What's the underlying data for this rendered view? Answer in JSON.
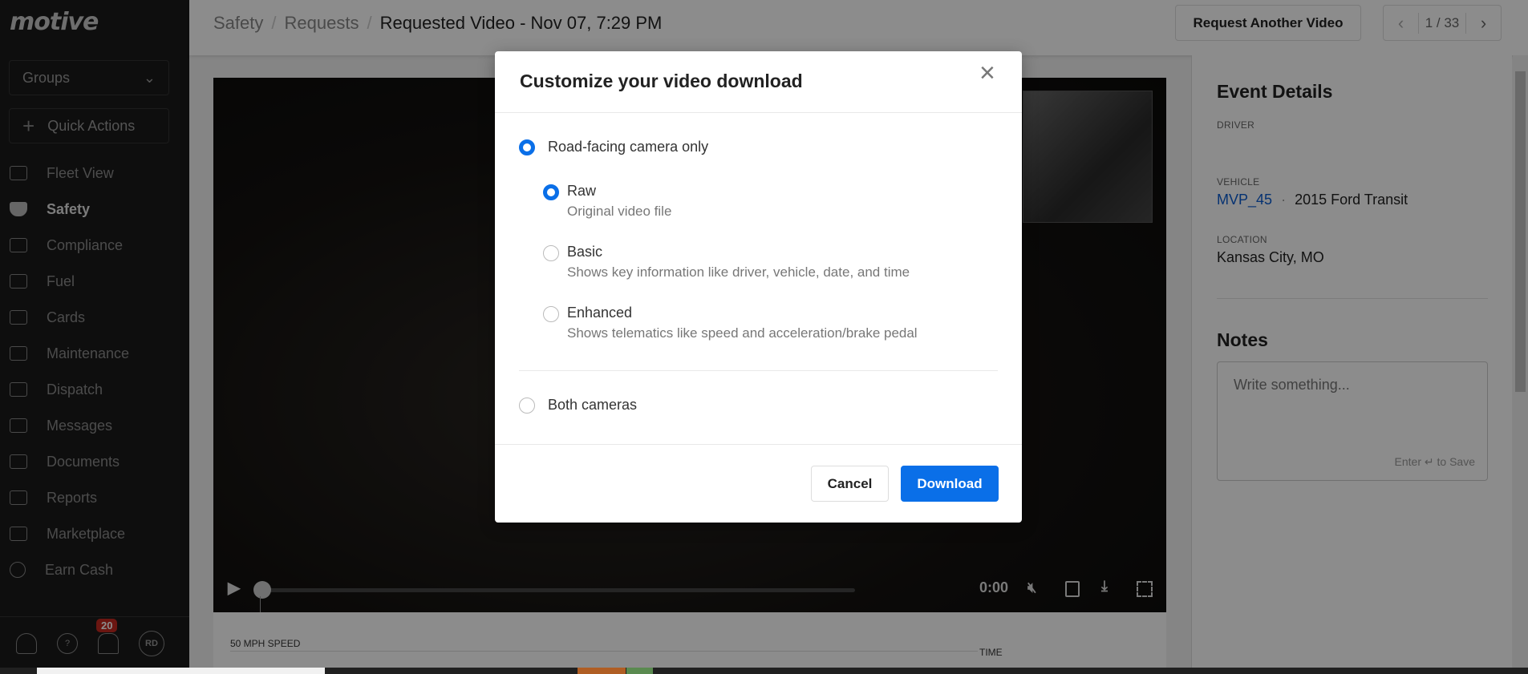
{
  "sidebar": {
    "logo": "motive",
    "groups_label": "Groups",
    "quick_actions_label": "Quick Actions",
    "items": [
      {
        "label": "Fleet View",
        "icon": "map-icon"
      },
      {
        "label": "Safety",
        "icon": "shield-icon",
        "active": true
      },
      {
        "label": "Compliance",
        "icon": "list-icon"
      },
      {
        "label": "Fuel",
        "icon": "fuel-pump-icon"
      },
      {
        "label": "Cards",
        "icon": "card-icon"
      },
      {
        "label": "Maintenance",
        "icon": "wrench-icon"
      },
      {
        "label": "Dispatch",
        "icon": "dispatch-icon"
      },
      {
        "label": "Messages",
        "icon": "messages-icon"
      },
      {
        "label": "Documents",
        "icon": "document-icon"
      },
      {
        "label": "Reports",
        "icon": "chart-icon"
      },
      {
        "label": "Marketplace",
        "icon": "layers-icon"
      },
      {
        "label": "Earn Cash",
        "icon": "dollar-icon"
      }
    ],
    "footer": {
      "help": "?",
      "notifications_count": "20",
      "avatar": "RD"
    }
  },
  "header": {
    "breadcrumb": [
      "Safety",
      "Requests"
    ],
    "separator": "/",
    "title": "Requested Video - Nov 07, 7:29 PM",
    "request_button": "Request Another Video",
    "pager": {
      "prev": "‹",
      "current": "1 / 33",
      "next": "›"
    }
  },
  "video": {
    "time": "0:00",
    "play": "▶",
    "progress": 0
  },
  "chart": {
    "speed_label": "50 MPH SPEED",
    "time_label": "TIME"
  },
  "details": {
    "title": "Event Details",
    "driver_label": "DRIVER",
    "vehicle_label": "VEHICLE",
    "vehicle_id": "MVP_45",
    "vehicle_dot": "·",
    "vehicle_model": "2015 Ford Transit",
    "location_label": "LOCATION",
    "location": "Kansas City, MO",
    "notes_title": "Notes",
    "notes_placeholder": "Write something...",
    "notes_hint": "Enter ↵ to Save"
  },
  "modal": {
    "title": "Customize your video download",
    "close": "×",
    "options": [
      {
        "label": "Road-facing camera only",
        "selected": true
      },
      {
        "label": "Both cameras",
        "selected": false
      }
    ],
    "sub_options": [
      {
        "label": "Raw",
        "description": "Original video file",
        "selected": true
      },
      {
        "label": "Basic",
        "description": "Shows key information like driver, vehicle, date, and time",
        "selected": false
      },
      {
        "label": "Enhanced",
        "description": "Shows telematics like speed and acceleration/brake pedal",
        "selected": false
      }
    ],
    "cancel": "Cancel",
    "download": "Download",
    "accent": "#0a6fe8"
  }
}
